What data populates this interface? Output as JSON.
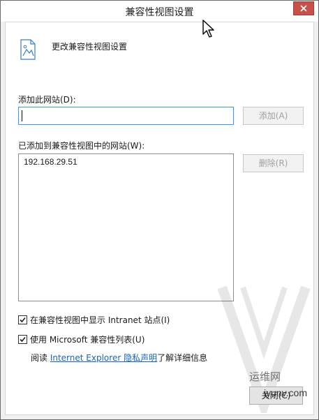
{
  "window": {
    "title": "兼容性视图设置",
    "close_icon": "close-icon",
    "close_color": "#c7504b"
  },
  "header": {
    "icon": "page-picture-icon",
    "label": "更改兼容性视图设置"
  },
  "add_site": {
    "label": "添加此网站(D):",
    "value": "",
    "button_label": "添加(A)"
  },
  "sites": {
    "label": "已添加到兼容性视图中的网站(W):",
    "items": [
      "192.168.29.51"
    ],
    "remove_button_label": "删除(R)"
  },
  "options": {
    "intranet_label": "在兼容性视图中显示 Intranet 站点(I)",
    "intranet_checked": true,
    "ms_list_label": "使用 Microsoft 兼容性列表(U)",
    "ms_list_checked": true
  },
  "privacy": {
    "prefix": "阅读 ",
    "link_text": "Internet Explorer 隐私声明",
    "suffix": "了解详细信息"
  },
  "footer": {
    "close_button_label": "关闭(C)"
  },
  "watermark": {
    "brand": "运维网",
    "url": "iyunv.com"
  },
  "colors": {
    "link": "#1565c0",
    "input_focus_border": "#3399ff"
  }
}
